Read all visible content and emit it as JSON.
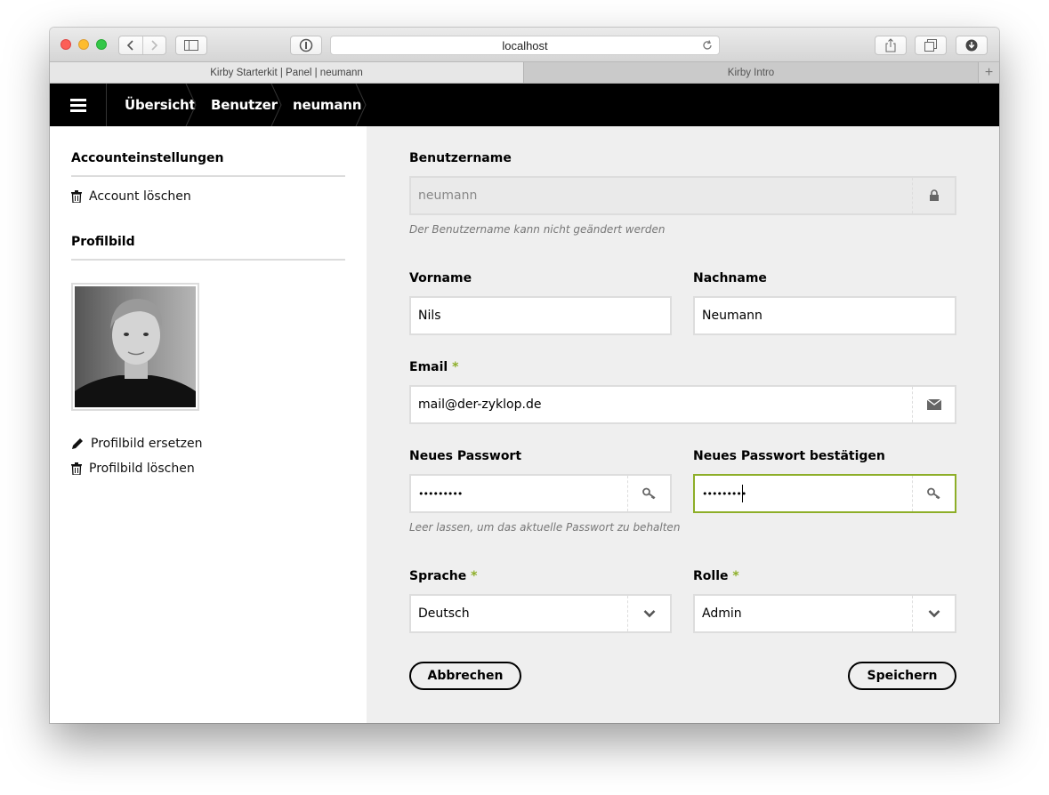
{
  "browser": {
    "url": "localhost",
    "tabs": [
      {
        "label": "Kirby Starterkit | Panel | neumann",
        "active": true
      },
      {
        "label": "Kirby Intro",
        "active": false
      }
    ],
    "new_tab_label": "+"
  },
  "breadcrumb": [
    "Übersicht",
    "Benutzer",
    "neumann"
  ],
  "sidebar": {
    "account_heading": "Accounteinstellungen",
    "delete_account": "Account löschen",
    "avatar_heading": "Profilbild",
    "replace_avatar": "Profilbild ersetzen",
    "delete_avatar": "Profilbild löschen"
  },
  "form": {
    "username": {
      "label": "Benutzername",
      "value": "neumann",
      "help": "Der Benutzername kann nicht geändert werden",
      "icon": "lock-icon"
    },
    "firstname": {
      "label": "Vorname",
      "value": "Nils"
    },
    "lastname": {
      "label": "Nachname",
      "value": "Neumann"
    },
    "email": {
      "label": "Email",
      "required": "*",
      "value": "mail@der-zyklop.de",
      "icon": "envelope-icon"
    },
    "password": {
      "label": "Neues Passwort",
      "value": "•••••••••",
      "help": "Leer lassen, um das aktuelle Passwort zu behalten",
      "icon": "key-icon"
    },
    "password_confirm": {
      "label": "Neues Passwort bestätigen",
      "value": "•••••••••",
      "icon": "key-icon"
    },
    "language": {
      "label": "Sprache",
      "required": "*",
      "value": "Deutsch",
      "icon": "chevron-down-icon"
    },
    "role": {
      "label": "Rolle",
      "required": "*",
      "value": "Admin",
      "icon": "chevron-down-icon"
    },
    "cancel": "Abbrechen",
    "save": "Speichern"
  },
  "colors": {
    "accent": "#8dae28",
    "header_bg": "#000000",
    "main_bg": "#efefef"
  }
}
